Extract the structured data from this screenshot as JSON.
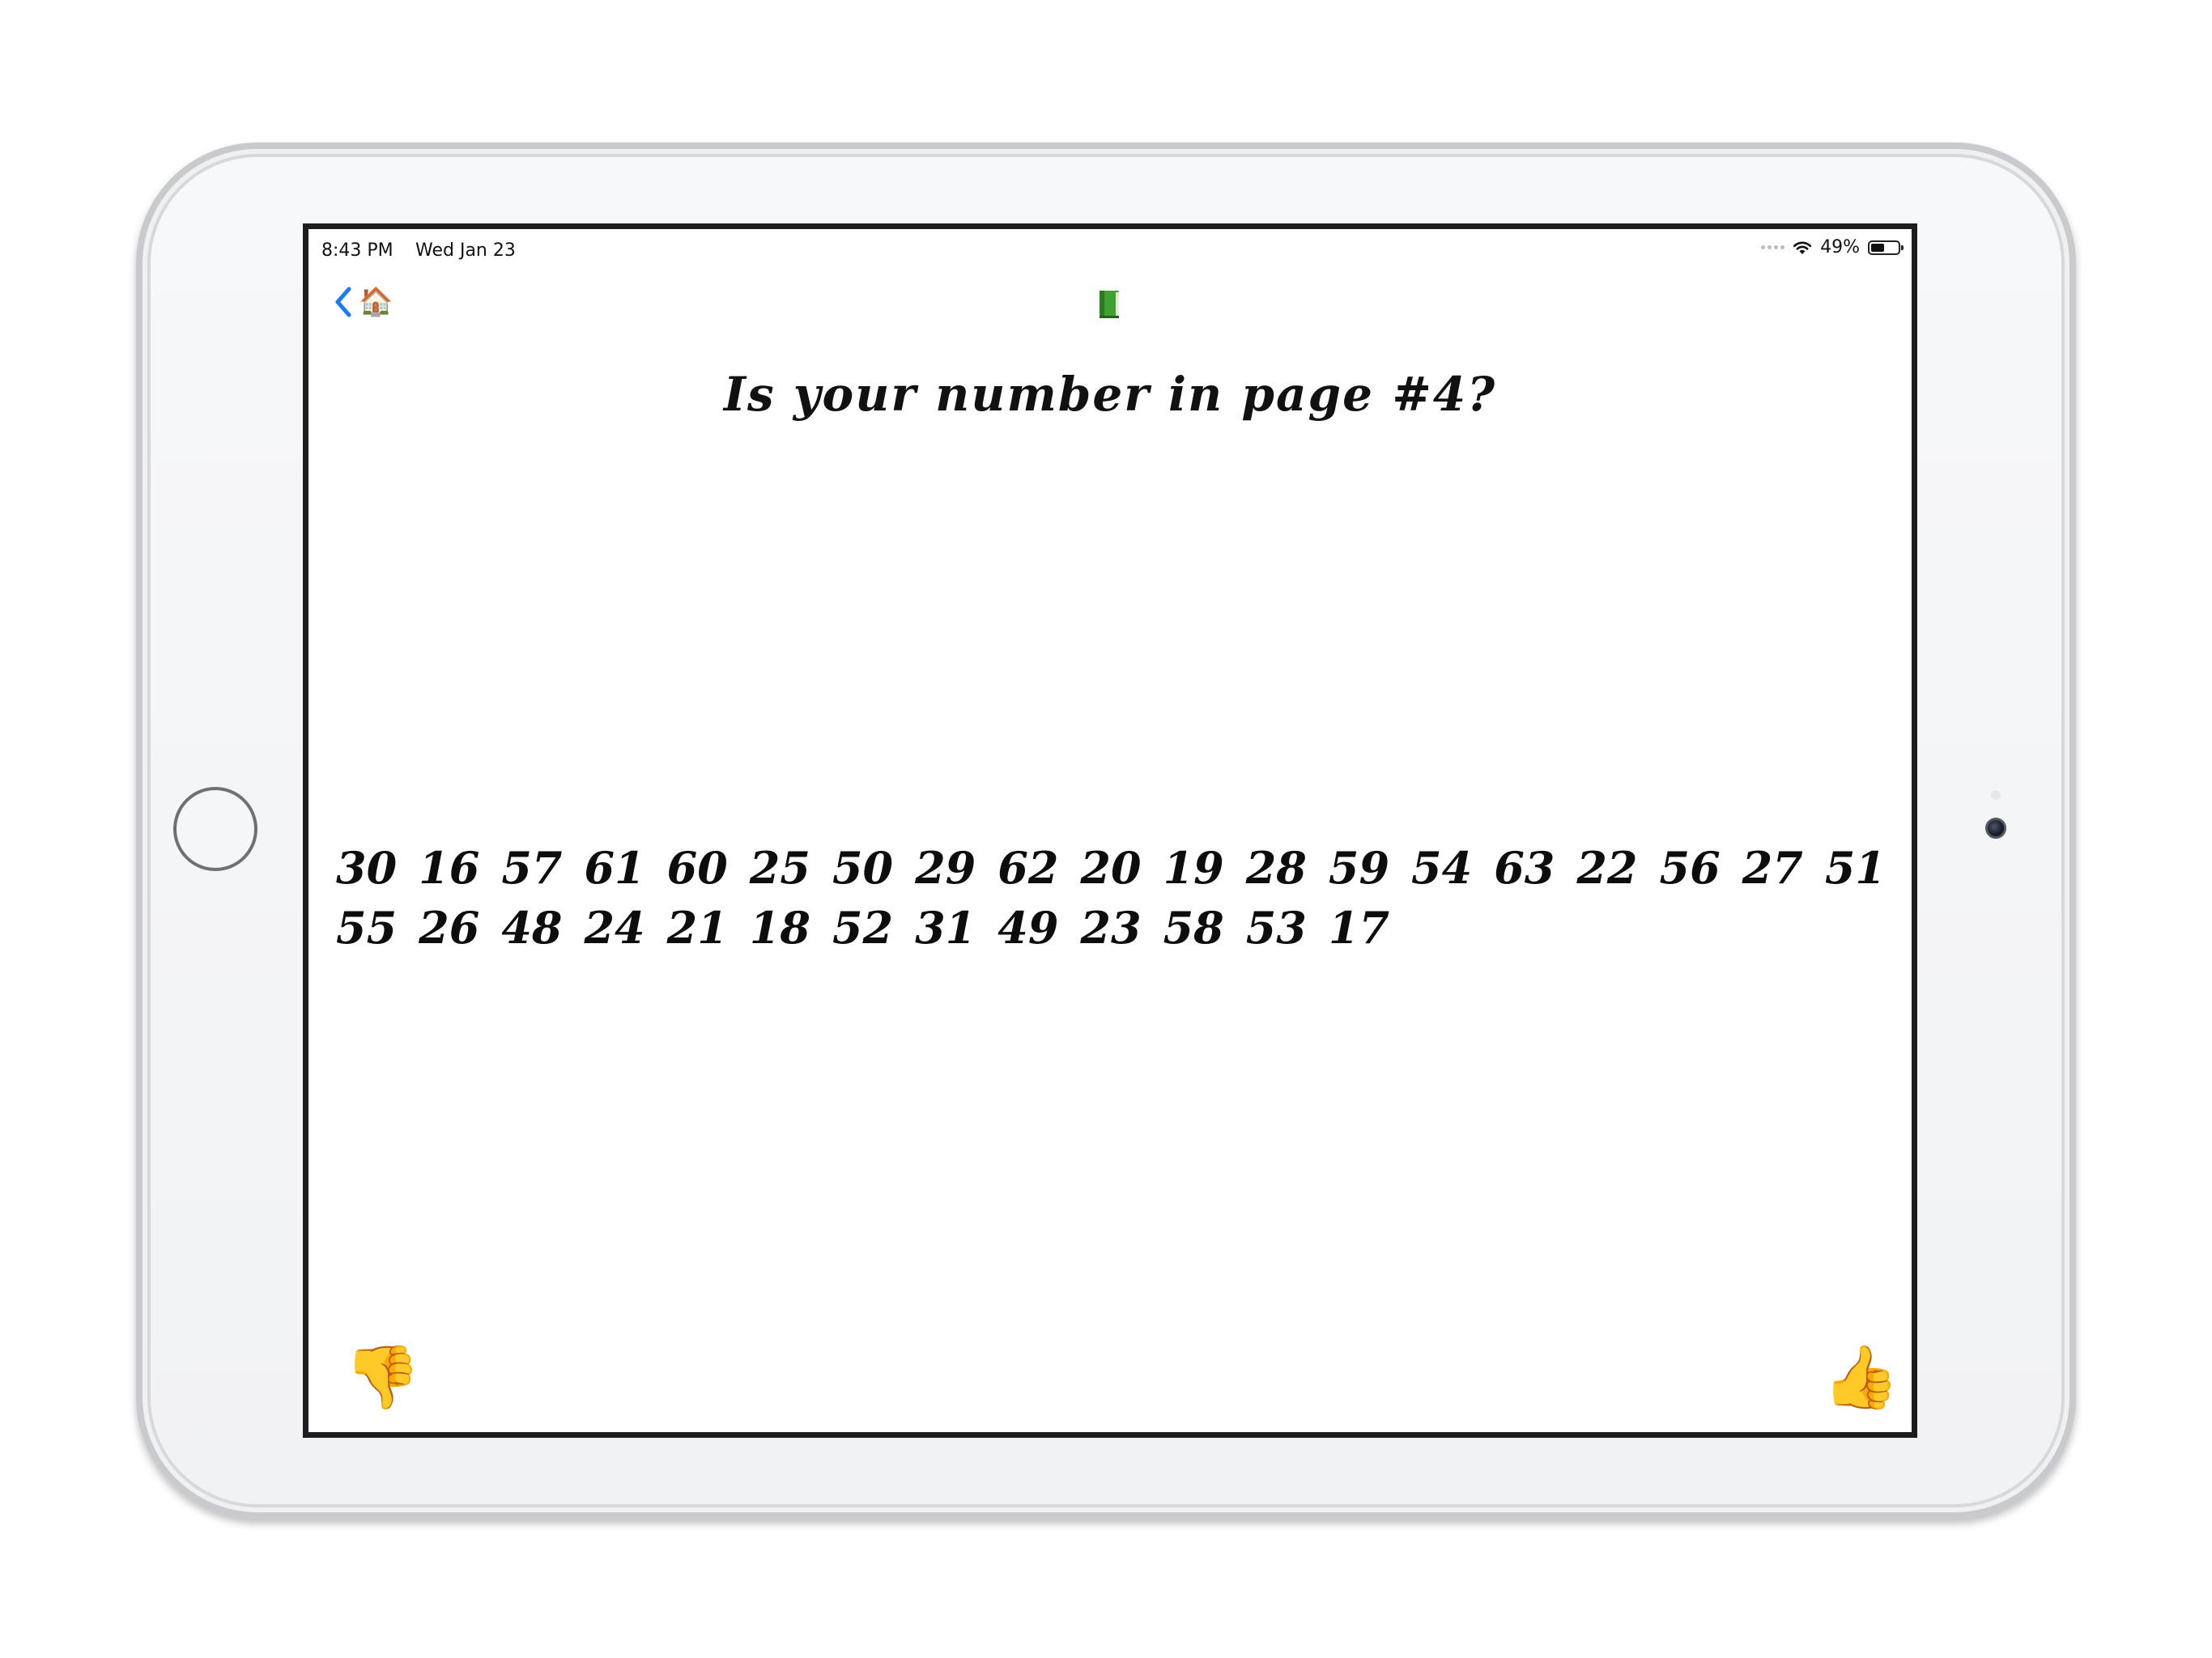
{
  "status_bar": {
    "time": "8:43 PM",
    "date": "Wed Jan 23",
    "battery_text": "49%",
    "battery_level": 0.49
  },
  "nav": {
    "back_icon": "chevron-left-icon",
    "home_emoji": "🏠",
    "center_icon": "green-book-icon"
  },
  "question": "Is your number in page #4?",
  "numbers": [
    "30",
    "16",
    "57",
    "61",
    "60",
    "25",
    "50",
    "29",
    "62",
    "20",
    "19",
    "28",
    "59",
    "54",
    "63",
    "22",
    "56",
    "27",
    "51",
    "55",
    "26",
    "48",
    "24",
    "21",
    "18",
    "52",
    "31",
    "49",
    "23",
    "58",
    "53",
    "17"
  ],
  "buttons": {
    "no_emoji": "👎",
    "yes_emoji": "👍"
  },
  "colors": {
    "accent": "#1a7cf5",
    "book": "#3fa12f"
  }
}
